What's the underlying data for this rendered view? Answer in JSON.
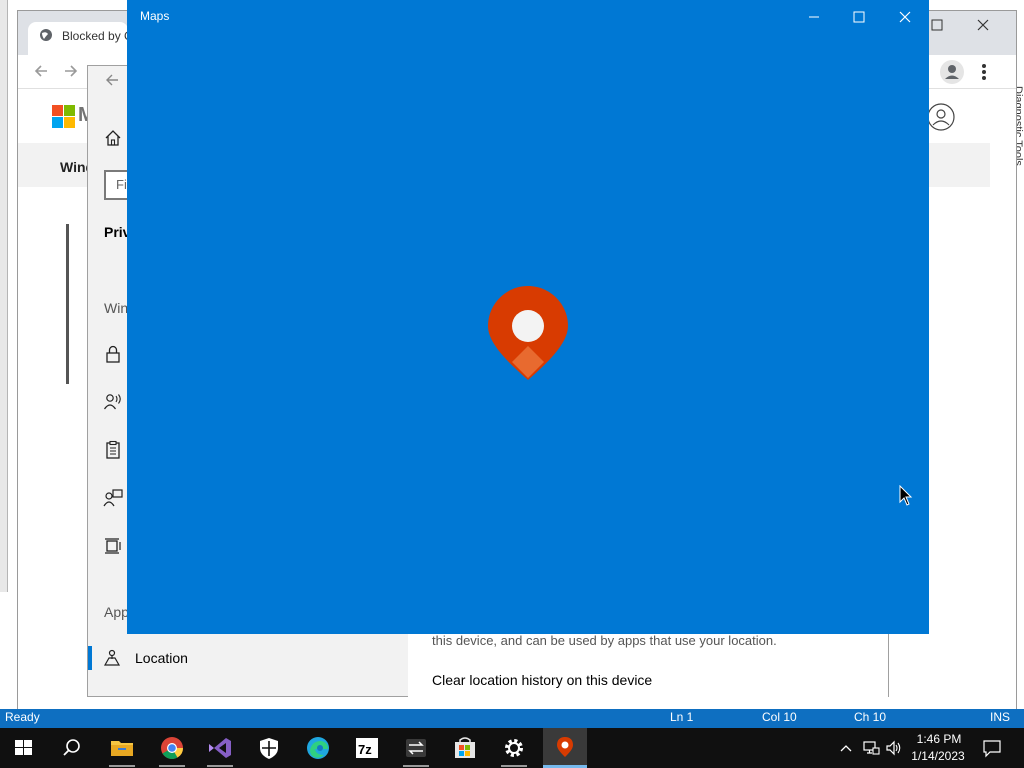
{
  "background_editor": {
    "side_panel_label": "Diagnostic Tools"
  },
  "browser": {
    "tab_title": "Blocked by G",
    "ms_logo_text": "M",
    "nav_text": "Wind"
  },
  "settings": {
    "search_placeholder": "Fi",
    "category_title": "Priv",
    "group_windows": "Win",
    "group_app": "App",
    "location_label": "Location",
    "location_description": "this device, and can be used by apps that use your location.",
    "clear_history_label": "Clear location history on this device"
  },
  "maps": {
    "title": "Maps",
    "accent_color": "#0078d4",
    "logo_color": "#d83b01"
  },
  "status_bar": {
    "ready": "Ready",
    "line": "Ln 1",
    "column": "Col 10",
    "character": "Ch 10",
    "insert_mode": "INS"
  },
  "taskbar": {
    "time": "1:46 PM",
    "date": "1/14/2023",
    "pinned": [
      "start-icon",
      "search-icon",
      "file-explorer-icon",
      "chrome-icon",
      "visual-studio-icon",
      "windows-security-icon",
      "edge-icon",
      "7zip-icon",
      "sync-icon",
      "microsoft-store-icon",
      "settings-icon",
      "maps-icon"
    ]
  }
}
